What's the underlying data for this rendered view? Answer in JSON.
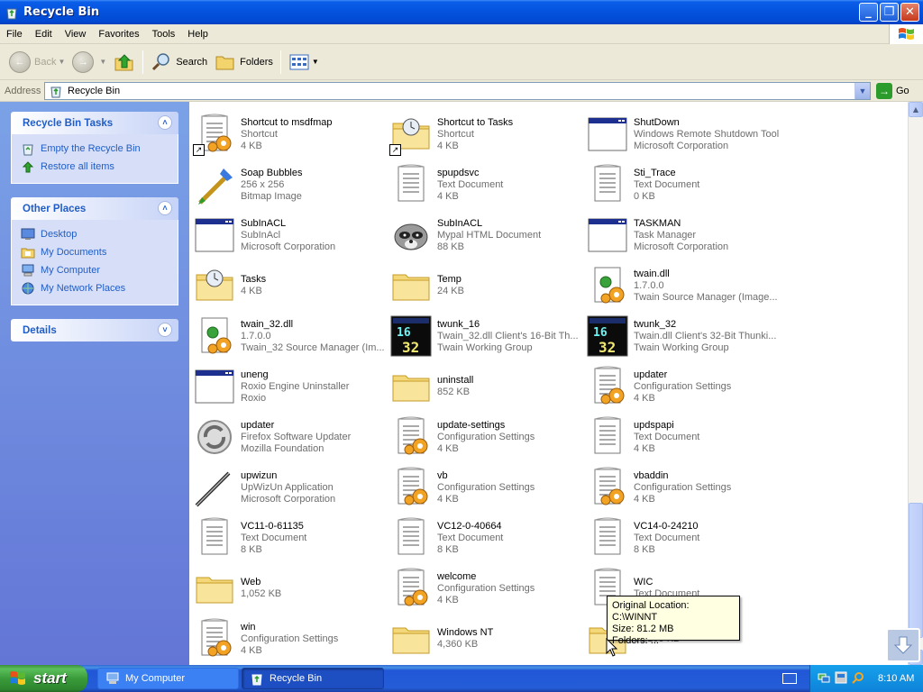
{
  "window": {
    "title": "Recycle Bin",
    "buttons": {
      "minimize": "_",
      "maximize": "❐",
      "close": "✕"
    }
  },
  "menu": [
    "File",
    "Edit",
    "View",
    "Favorites",
    "Tools",
    "Help"
  ],
  "toolbar": {
    "back": "Back",
    "search": "Search",
    "folders": "Folders"
  },
  "address": {
    "label": "Address",
    "value": "Recycle Bin",
    "go": "Go"
  },
  "taskpane": {
    "tasks": {
      "title": "Recycle Bin Tasks",
      "items": [
        "Empty the Recycle Bin",
        "Restore all items"
      ]
    },
    "places": {
      "title": "Other Places",
      "items": [
        "Desktop",
        "My Documents",
        "My Computer",
        "My Network Places"
      ]
    },
    "details": {
      "title": "Details"
    }
  },
  "files": [
    {
      "name": "Shortcut to msdfmap",
      "line2": "Shortcut",
      "line3": "4 KB",
      "icon": "cfg-shortcut"
    },
    {
      "name": "Shortcut to Tasks",
      "line2": "Shortcut",
      "line3": "4 KB",
      "icon": "tasks-shortcut"
    },
    {
      "name": "ShutDown",
      "line2": "Windows Remote Shutdown Tool",
      "line3": "Microsoft Corporation",
      "icon": "app"
    },
    {
      "name": "Soap Bubbles",
      "line2": "256 x 256",
      "line3": "Bitmap Image",
      "icon": "paint"
    },
    {
      "name": "spupdsvc",
      "line2": "Text Document",
      "line3": "4 KB",
      "icon": "text"
    },
    {
      "name": "Sti_Trace",
      "line2": "Text Document",
      "line3": "0 KB",
      "icon": "text"
    },
    {
      "name": "SubInACL",
      "line2": "SubInAcl",
      "line3": "Microsoft Corporation",
      "icon": "app"
    },
    {
      "name": "SubInACL",
      "line2": "Mypal HTML Document",
      "line3": "88 KB",
      "icon": "raccoon"
    },
    {
      "name": "TASKMAN",
      "line2": "Task Manager",
      "line3": "Microsoft Corporation",
      "icon": "app"
    },
    {
      "name": "Tasks",
      "line2": "4 KB",
      "line3": "",
      "icon": "tasks"
    },
    {
      "name": "Temp",
      "line2": "24 KB",
      "line3": "",
      "icon": "folder"
    },
    {
      "name": "twain.dll",
      "line2": "1.7.0.0",
      "line3": "Twain Source Manager (Image...",
      "icon": "dll"
    },
    {
      "name": "twain_32.dll",
      "line2": "1.7.0.0",
      "line3": "Twain_32 Source Manager (Im...",
      "icon": "dll"
    },
    {
      "name": "twunk_16",
      "line2": "Twain_32.dll Client's 16-Bit Th...",
      "line3": "Twain Working Group",
      "icon": "twunk16"
    },
    {
      "name": "twunk_32",
      "line2": "Twain.dll Client's 32-Bit Thunki...",
      "line3": "Twain Working Group",
      "icon": "twunk32"
    },
    {
      "name": "uneng",
      "line2": "Roxio Engine Uninstaller",
      "line3": "Roxio",
      "icon": "app"
    },
    {
      "name": "uninstall",
      "line2": "852 KB",
      "line3": "",
      "icon": "folder"
    },
    {
      "name": "updater",
      "line2": "Configuration Settings",
      "line3": "4 KB",
      "icon": "cfg"
    },
    {
      "name": "updater",
      "line2": "Firefox Software Updater",
      "line3": "Mozilla Foundation",
      "icon": "updater"
    },
    {
      "name": "update-settings",
      "line2": "Configuration Settings",
      "line3": "4 KB",
      "icon": "cfg"
    },
    {
      "name": "updspapi",
      "line2": "Text Document",
      "line3": "4 KB",
      "icon": "text"
    },
    {
      "name": "upwizun",
      "line2": "UpWizUn Application",
      "line3": "Microsoft Corporation",
      "icon": "wand"
    },
    {
      "name": "vb",
      "line2": "Configuration Settings",
      "line3": "4 KB",
      "icon": "cfg"
    },
    {
      "name": "vbaddin",
      "line2": "Configuration Settings",
      "line3": "4 KB",
      "icon": "cfg"
    },
    {
      "name": "VC11-0-61135",
      "line2": "Text Document",
      "line3": "8 KB",
      "icon": "text"
    },
    {
      "name": "VC12-0-40664",
      "line2": "Text Document",
      "line3": "8 KB",
      "icon": "text"
    },
    {
      "name": "VC14-0-24210",
      "line2": "Text Document",
      "line3": "8 KB",
      "icon": "text"
    },
    {
      "name": "Web",
      "line2": "1,052 KB",
      "line3": "",
      "icon": "folder"
    },
    {
      "name": "welcome",
      "line2": "Configuration Settings",
      "line3": "4 KB",
      "icon": "cfg"
    },
    {
      "name": "WIC",
      "line2": "Text Document",
      "line3": "",
      "icon": "text"
    },
    {
      "name": "win",
      "line2": "Configuration Settings",
      "line3": "4 KB",
      "icon": "cfg"
    },
    {
      "name": "Windows NT",
      "line2": "4,360 KB",
      "line3": "",
      "icon": "folder"
    },
    {
      "name": "",
      "line2": "83,160 KB",
      "line3": "",
      "icon": "folder"
    }
  ],
  "tooltip": {
    "line1": "Original Location: C:\\WINNT",
    "line2": "Size: 81.2 MB",
    "line3": "Folders: ..."
  },
  "taskbar": {
    "start": "start",
    "tasks": [
      {
        "label": "My Computer",
        "active": false
      },
      {
        "label": "Recycle Bin",
        "active": true
      }
    ],
    "clock": "8:10 AM"
  }
}
